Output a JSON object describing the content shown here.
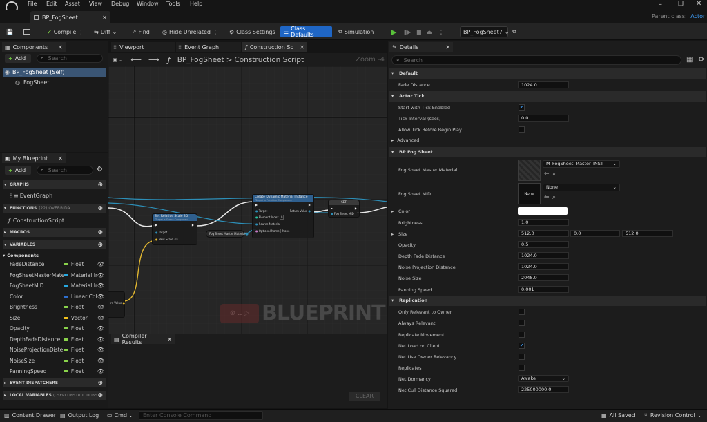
{
  "menu": {
    "items": [
      "File",
      "Edit",
      "Asset",
      "View",
      "Debug",
      "Window",
      "Tools",
      "Help"
    ],
    "parent_class_label": "Parent class:",
    "parent_class_value": "Actor"
  },
  "document_tab": {
    "label": "BP_FogSheet"
  },
  "toolbar": {
    "compile": "Compile",
    "diff": "Diff",
    "find": "Find",
    "hide_unrelated": "Hide Unrelated",
    "class_settings": "Class Settings",
    "class_defaults": "Class Defaults",
    "simulation": "Simulation",
    "debug_object": "BP_FogSheet7"
  },
  "components": {
    "title": "Components",
    "add": "Add",
    "search_placeholder": "Search",
    "items": [
      {
        "label": "BP_FogSheet (Self)"
      },
      {
        "label": "FogSheet"
      }
    ]
  },
  "my_blueprint": {
    "title": "My Blueprint",
    "add": "Add",
    "search_placeholder": "Search",
    "graphs_header": "GRAPHS",
    "event_graph": "EventGraph",
    "functions_header": "FUNCTIONS",
    "functions_note": "(22) OVERRIDA",
    "construction_script": "ConstructionScript",
    "macros_header": "MACROS",
    "variables_header": "VARIABLES",
    "components_group": "Components",
    "variables": [
      {
        "name": "FadeDistance",
        "type": "Float",
        "color": "#8ad34b"
      },
      {
        "name": "FogSheetMasterMate",
        "type": "Material In",
        "color": "#27a9e1"
      },
      {
        "name": "FogSheetMID",
        "type": "Material In",
        "color": "#27a9e1"
      },
      {
        "name": "Color",
        "type": "Linear Col",
        "color": "#2e6fcf"
      },
      {
        "name": "Brightness",
        "type": "Float",
        "color": "#8ad34b"
      },
      {
        "name": "Size",
        "type": "Vector",
        "color": "#f4c31c"
      },
      {
        "name": "Opacity",
        "type": "Float",
        "color": "#8ad34b"
      },
      {
        "name": "DepthFadeDistance",
        "type": "Float",
        "color": "#8ad34b"
      },
      {
        "name": "NoiseProjectionDiste",
        "type": "Float",
        "color": "#8ad34b"
      },
      {
        "name": "NoiseSize",
        "type": "Float",
        "color": "#8ad34b"
      },
      {
        "name": "PanningSpeed",
        "type": "Float",
        "color": "#8ad34b"
      }
    ],
    "event_dispatchers_header": "EVENT DISPATCHERS",
    "local_variables_header": "LOCAL VARIABLES",
    "local_variables_note": "(USERCONSTRUCTIONS"
  },
  "graph_tabs": {
    "viewport": "Viewport",
    "event_graph": "Event Graph",
    "construction": "Construction Sc"
  },
  "graph": {
    "breadcrumb_root": "BP_FogSheet",
    "breadcrumb_sep": ">",
    "breadcrumb_leaf": "Construction Script",
    "zoom": "Zoom -4",
    "watermark": "BLUEPRINT",
    "nodes": {
      "set_scale": {
        "title": "Set Relative Scale 3D",
        "subtitle": "Target is Scene Component",
        "target": "Target",
        "new_scale": "New Scale 3D"
      },
      "create_mid": {
        "title": "Create Dynamic Material Instance",
        "subtitle": "Target is Primitive Component",
        "target": "Target",
        "element_index": "Element Index",
        "element_index_value": "0",
        "source_material": "Source Material",
        "optional_name": "Optional Name",
        "optional_name_value": "None",
        "return_value": "Return Value"
      },
      "set_node": {
        "title": "SET",
        "pin": "Fog Sheet MID"
      },
      "get_material": {
        "label": "Fog Sheet Master Material"
      },
      "reroute_left": {
        "label": "rn Value"
      }
    }
  },
  "compiler": {
    "title": "Compiler Results",
    "clear": "CLEAR"
  },
  "details": {
    "title": "Details",
    "search_placeholder": "Search",
    "sections": {
      "default": "Default",
      "actor_tick": "Actor Tick",
      "bp_fog_sheet": "BP Fog Sheet",
      "replication": "Replication"
    },
    "fade_distance": {
      "label": "Fade Distance",
      "value": "1024.0"
    },
    "start_tick": {
      "label": "Start with Tick Enabled",
      "checked": true
    },
    "tick_interval": {
      "label": "Tick Interval (secs)",
      "value": "0.0"
    },
    "allow_tick": {
      "label": "Allow Tick Before Begin Play",
      "checked": false
    },
    "advanced": "Advanced",
    "master_material": {
      "label": "Fog Sheet Master Material",
      "value": "M_FogSheet_Master_INST"
    },
    "mid": {
      "label": "Fog Sheet MID",
      "value": "None",
      "thumb": "None"
    },
    "color": {
      "label": "Color",
      "value": "#ffffff"
    },
    "brightness": {
      "label": "Brightness",
      "value": "1.0"
    },
    "size": {
      "label": "Size",
      "x": "512.0",
      "y": "0.0",
      "z": "512.0"
    },
    "opacity": {
      "label": "Opacity",
      "value": "0.5"
    },
    "depth_fade": {
      "label": "Depth Fade Distance",
      "value": "1024.0"
    },
    "noise_projection": {
      "label": "Noise Projection Distance",
      "value": "1024.0"
    },
    "noise_size": {
      "label": "Noise Size",
      "value": "2048.0"
    },
    "panning_speed": {
      "label": "Panning Speed",
      "value": "0.001"
    },
    "only_relevant": {
      "label": "Only Relevant to Owner",
      "checked": false
    },
    "always_relevant": {
      "label": "Always Relevant",
      "checked": false
    },
    "replicate_movement": {
      "label": "Replicate Movement",
      "checked": false
    },
    "net_load": {
      "label": "Net Load on Client",
      "checked": true
    },
    "net_owner_relevancy": {
      "label": "Net Use Owner Relevancy",
      "checked": false
    },
    "replicates": {
      "label": "Replicates",
      "checked": false
    },
    "net_dormancy": {
      "label": "Net Dormancy",
      "value": "Awake"
    },
    "net_cull": {
      "label": "Net Cull Distance Squared",
      "value": "225000000.0"
    }
  },
  "status": {
    "content_drawer": "Content Drawer",
    "output_log": "Output Log",
    "cmd": "Cmd",
    "console_placeholder": "Enter Console Command",
    "all_saved": "All Saved",
    "revision_control": "Revision Control"
  }
}
